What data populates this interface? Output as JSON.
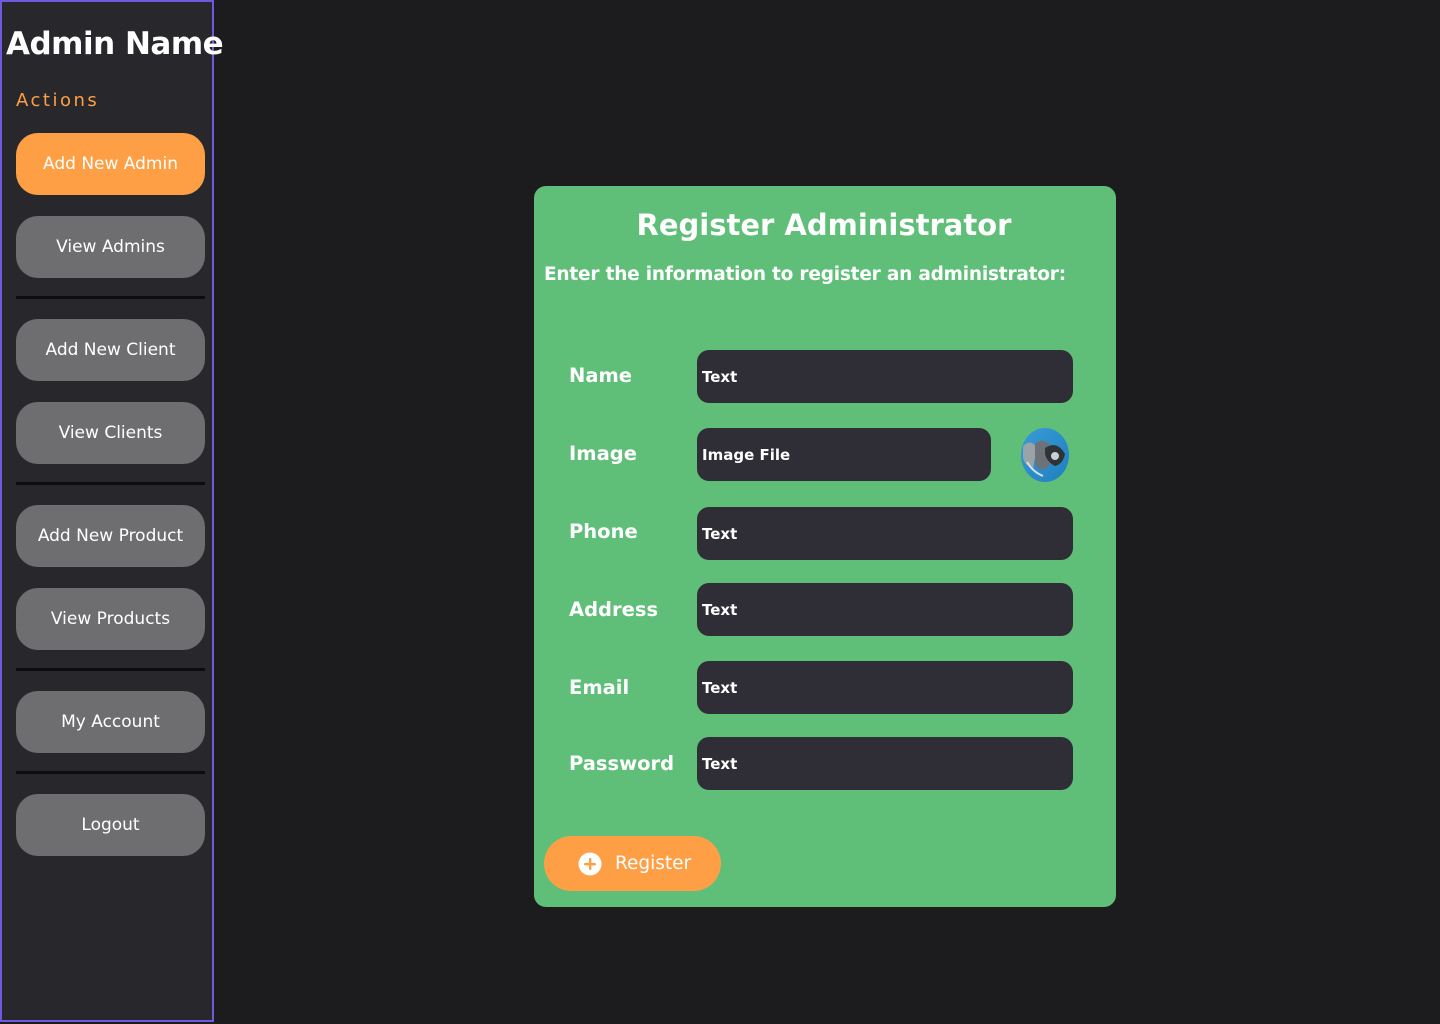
{
  "sidebar": {
    "admin_name": "Admin Name",
    "actions_label": "Actions",
    "items": [
      {
        "label": "Add New Admin"
      },
      {
        "label": "View Admins"
      },
      {
        "label": "Add New Client"
      },
      {
        "label": "View Clients"
      },
      {
        "label": "Add New Product"
      },
      {
        "label": "View Products"
      },
      {
        "label": "My Account"
      },
      {
        "label": "Logout"
      }
    ]
  },
  "form": {
    "title": "Register Administrator",
    "subtitle": "Enter the information to register an administrator:",
    "fields": [
      {
        "label": "Name",
        "value": "Text"
      },
      {
        "label": "Image",
        "value": "Image File"
      },
      {
        "label": "Phone",
        "value": "Text"
      },
      {
        "label": "Address",
        "value": "Text"
      },
      {
        "label": "Email",
        "value": "Text"
      },
      {
        "label": "Password",
        "value": "Text"
      }
    ],
    "register_label": "Register"
  },
  "colors": {
    "accent": "#ff9f45",
    "card": "#5fbf79",
    "sidebar_border": "#6d5ae0",
    "input_bg": "#2f2d35",
    "nav_button": "#6e6e70"
  },
  "icons": {
    "register": "plus-circle-icon",
    "avatar": "image-preview"
  }
}
